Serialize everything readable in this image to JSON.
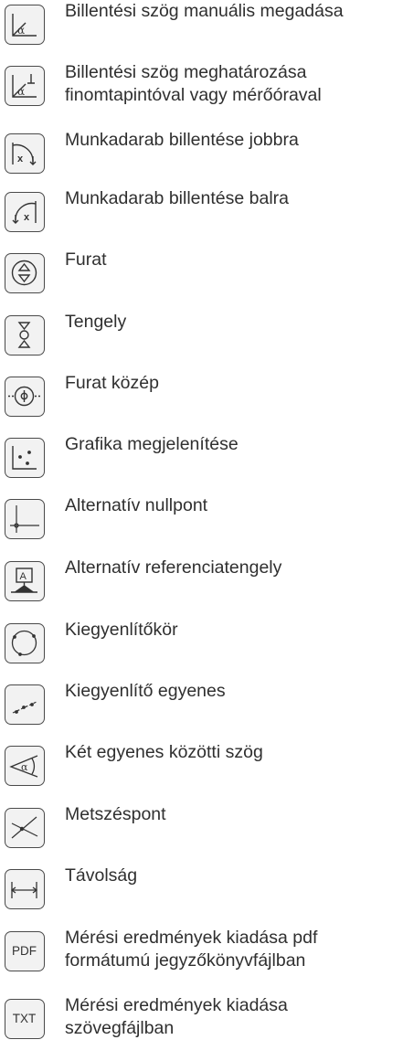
{
  "items": [
    {
      "icon": "tilt-angle-manual-icon",
      "lines": [
        "Billentési szög manuális megadása"
      ]
    },
    {
      "icon": "tilt-angle-probe-icon",
      "lines": [
        "Billentési szög meghatározása",
        "finomtapintóval vagy mérőóraval"
      ]
    },
    {
      "icon": "tilt-right-icon",
      "lines": [
        "Munkadarab billentése jobbra"
      ]
    },
    {
      "icon": "tilt-left-icon",
      "lines": [
        "Munkadarab billentése balra"
      ]
    },
    {
      "icon": "bore-icon",
      "lines": [
        "Furat"
      ]
    },
    {
      "icon": "shaft-icon",
      "lines": [
        "Tengely"
      ]
    },
    {
      "icon": "bore-center-icon",
      "lines": [
        "Furat közép"
      ]
    },
    {
      "icon": "graphic-display-icon",
      "lines": [
        "Grafika megjelenítése"
      ]
    },
    {
      "icon": "alternative-zero-icon",
      "lines": [
        "Alternatív nullpont"
      ]
    },
    {
      "icon": "alternative-reference-axis-icon",
      "lines": [
        "Alternatív referenciatengely"
      ]
    },
    {
      "icon": "best-fit-circle-icon",
      "lines": [
        "Kiegyenlítőkör"
      ]
    },
    {
      "icon": "best-fit-line-icon",
      "lines": [
        "Kiegyenlítő egyenes"
      ]
    },
    {
      "icon": "angle-between-lines-icon",
      "lines": [
        "Két egyenes közötti szög"
      ]
    },
    {
      "icon": "intersection-icon",
      "lines": [
        "Metszéspont"
      ]
    },
    {
      "icon": "distance-icon",
      "lines": [
        "Távolság"
      ]
    },
    {
      "icon": "pdf-icon",
      "badge": "PDF",
      "lines": [
        "Mérési eredmények kiadása pdf",
        "formátumú jegyzőkönyvfájlban"
      ]
    },
    {
      "icon": "txt-icon",
      "badge": "TXT",
      "lines": [
        "Mérési eredmények kiadása",
        "szövegfájlban"
      ]
    }
  ]
}
